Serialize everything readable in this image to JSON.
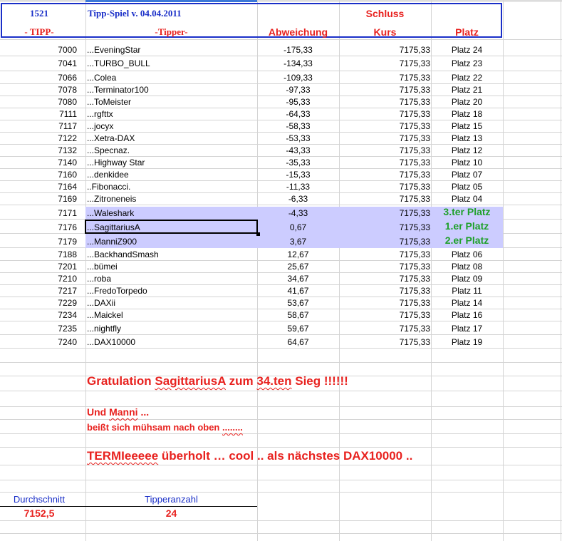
{
  "header": {
    "id": "1521",
    "title": "Tipp-Spiel v. 04.04.2011",
    "schluss": "Schluss",
    "col_tipp": "- TIPP-",
    "col_tipper": "-Tipper-",
    "col_abweichung": "Abweichung",
    "col_kurs": "Kurs",
    "col_platz": "Platz"
  },
  "rows": [
    {
      "tipp": "7000",
      "tipper": "...EveningStar",
      "abw": "-175,33",
      "kurs": "7175,33",
      "platz": "Platz 24"
    },
    {
      "tipp": "7041",
      "tipper": "...TURBO_BULL",
      "abw": "-134,33",
      "kurs": "7175,33",
      "platz": "Platz 23"
    },
    {
      "tipp": "7066",
      "tipper": "...Colea",
      "abw": "-109,33",
      "kurs": "7175,33",
      "platz": "Platz 22"
    },
    {
      "tipp": "7078",
      "tipper": "...Terminator100",
      "abw": "-97,33",
      "kurs": "7175,33",
      "platz": "Platz 21"
    },
    {
      "tipp": "7080",
      "tipper": "...ToMeister",
      "abw": "-95,33",
      "kurs": "7175,33",
      "platz": "Platz 20"
    },
    {
      "tipp": "7111",
      "tipper": "...rgfttx",
      "abw": "-64,33",
      "kurs": "7175,33",
      "platz": "Platz 18"
    },
    {
      "tipp": "7117",
      "tipper": "...jocyx",
      "abw": "-58,33",
      "kurs": "7175,33",
      "platz": "Platz 15"
    },
    {
      "tipp": "7122",
      "tipper": "...Xetra-DAX",
      "abw": "-53,33",
      "kurs": "7175,33",
      "platz": "Platz 13"
    },
    {
      "tipp": "7132",
      "tipper": "...Specnaz.",
      "abw": "-43,33",
      "kurs": "7175,33",
      "platz": "Platz 12"
    },
    {
      "tipp": "7140",
      "tipper": "...Highway Star",
      "abw": "-35,33",
      "kurs": "7175,33",
      "platz": "Platz 10"
    },
    {
      "tipp": "7160",
      "tipper": "...denkidee",
      "abw": "-15,33",
      "kurs": "7175,33",
      "platz": "Platz 07"
    },
    {
      "tipp": "7164",
      "tipper": "..Fibonacci.",
      "abw": "-11,33",
      "kurs": "7175,33",
      "platz": "Platz 05"
    },
    {
      "tipp": "7169",
      "tipper": "...Zitroneneis",
      "abw": "-6,33",
      "kurs": "7175,33",
      "platz": "Platz 04"
    },
    {
      "tipp": "7171",
      "tipper": "...Waleshark",
      "abw": "-4,33",
      "kurs": "7175,33",
      "platz": "3.ter Platz"
    },
    {
      "tipp": "7176",
      "tipper": "...SagittariusA",
      "abw": "0,67",
      "kurs": "7175,33",
      "platz": "1.er Platz"
    },
    {
      "tipp": "7179",
      "tipper": "...ManniZ900",
      "abw": "3,67",
      "kurs": "7175,33",
      "platz": "2.er Platz"
    },
    {
      "tipp": "7188",
      "tipper": "...BackhandSmash",
      "abw": "12,67",
      "kurs": "7175,33",
      "platz": "Platz 06"
    },
    {
      "tipp": "7201",
      "tipper": "...bümei",
      "abw": "25,67",
      "kurs": "7175,33",
      "platz": "Platz 08"
    },
    {
      "tipp": "7210",
      "tipper": "...roba",
      "abw": "34,67",
      "kurs": "7175,33",
      "platz": "Platz 09"
    },
    {
      "tipp": "7217",
      "tipper": "...FredoTorpedo",
      "abw": "41,67",
      "kurs": "7175,33",
      "platz": "Platz 11"
    },
    {
      "tipp": "7229",
      "tipper": "...DAXii",
      "abw": "53,67",
      "kurs": "7175,33",
      "platz": "Platz 14"
    },
    {
      "tipp": "7234",
      "tipper": "...Maickel",
      "abw": "58,67",
      "kurs": "7175,33",
      "platz": "Platz 16"
    },
    {
      "tipp": "7235",
      "tipper": "...nightfly",
      "abw": "59,67",
      "kurs": "7175,33",
      "platz": "Platz 17"
    },
    {
      "tipp": "7240",
      "tipper": "...DAX10000",
      "abw": "64,67",
      "kurs": "7175,33",
      "platz": "Platz 19"
    }
  ],
  "messages": {
    "gratulation_pre": "Gratulation ",
    "gratulation_name": "SagittariusA",
    "gratulation_mid": " zum  ",
    "gratulation_num": "34.ten",
    "gratulation_post": " Sieg !!!!!!",
    "und_pre": "Und ",
    "und_name": "Manni",
    "und_post": " ...",
    "beisst_pre": "beißt sich mühsam nach oben ",
    "beisst_dots": "........",
    "termi_name": "TERMIeeeee",
    "termi_post": "  überholt  … cool  .. als nächstes DAX10000 .."
  },
  "summary": {
    "durchschnitt_label": "Durchschnitt",
    "durchschnitt_value": "7152,5",
    "tipperanzahl_label": "Tipperanzahl",
    "tipperanzahl_value": "24"
  },
  "colors": {
    "red": "#e8221f",
    "blue": "#1a2fc8",
    "green": "#1fa02a",
    "highlight": "#ccccff"
  }
}
